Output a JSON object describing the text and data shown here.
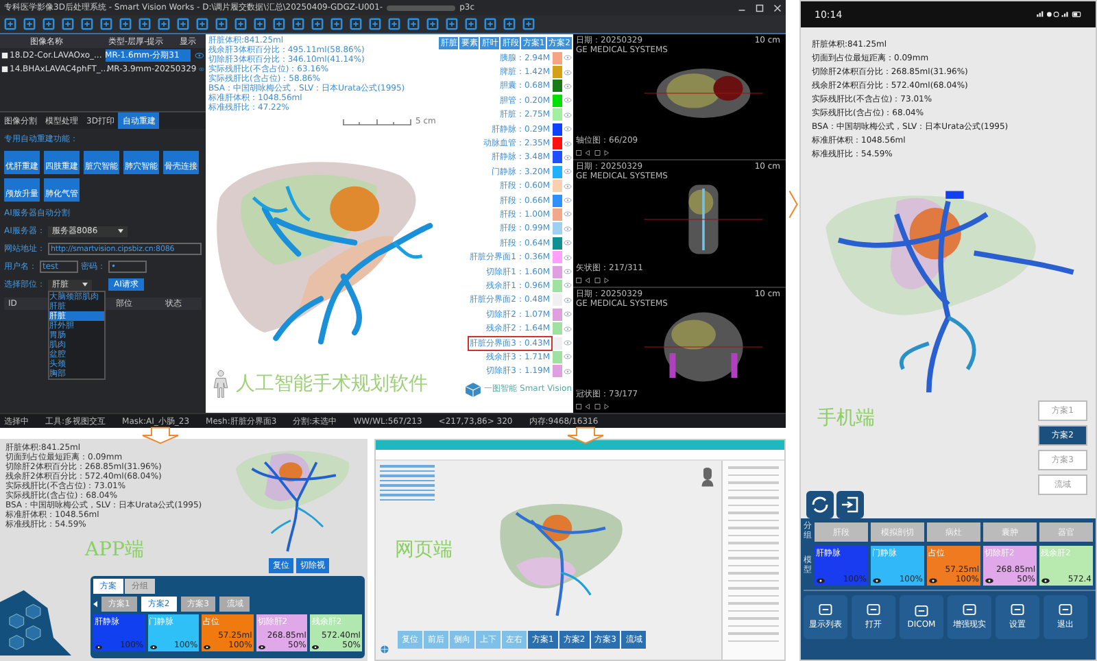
{
  "desktop": {
    "title": "专科医学影像3D后处理系统 - Smart Vision Works - D:\\调片履交数据\\汇总\\20250409-GDGZ-U001-",
    "file_suffix": "p3c",
    "series_table": {
      "columns": [
        "图像名称",
        "类型-层厚-提示",
        "显示"
      ],
      "rows": [
        {
          "name": "18.D2-Cor.LAVAOxo_...",
          "type": "MR-1.6mm-分期31",
          "selected": true
        },
        {
          "name": "14.BHAxLAVAC4phFT_...",
          "type": "MR-3.9mm-20250329",
          "selected": false
        }
      ]
    },
    "tabs": [
      {
        "label": "图像分割",
        "selected": false
      },
      {
        "label": "模型处理",
        "selected": false
      },
      {
        "label": "3D打印",
        "selected": false
      },
      {
        "label": "自动重建",
        "selected": true
      }
    ],
    "auto_recon": {
      "heading": "专用自动重建功能：",
      "buttons": [
        "优肝重建",
        "四肢重建",
        "脏穴智能",
        "肺穴智能",
        "骨壳连接",
        "颅放升量",
        "肺化气管"
      ]
    },
    "ai": {
      "heading": "AI服务器自动分割",
      "server_label": "AI服务器：",
      "server_value": "服务器8086",
      "url_label": "网站地址：",
      "url_value": "http://smartvision.cipsbiz.cn:8086",
      "user_label": "用户名：",
      "user_value": "test",
      "password_label": "密码：",
      "password_value": "•",
      "part_label": "选择部位：",
      "part_value": "肝脏",
      "request_button": "AI请求",
      "options": [
        {
          "label": "大脑颈部肌肉",
          "selected": false
        },
        {
          "label": "肝脏",
          "selected": false
        },
        {
          "label": "肝脏",
          "selected": true
        },
        {
          "label": "肝外胆",
          "selected": false
        },
        {
          "label": "胃肠",
          "selected": false
        },
        {
          "label": "肌肉",
          "selected": false
        },
        {
          "label": "盆腔",
          "selected": false
        },
        {
          "label": "头颈",
          "selected": false
        },
        {
          "label": "胸部",
          "selected": false
        }
      ]
    },
    "result_table": {
      "columns": [
        "ID",
        "部位",
        "状态"
      ]
    },
    "viewport": {
      "stats": [
        "肝脏体积:841.25ml",
        "残余肝3体积百分比：495.11ml(58.86%)",
        "切除肝3体积百分比：346.10ml(41.14%)",
        "实际残肝比(不含占位)：63.16%",
        "实际残肝比(含占位)：58.86%",
        "BSA：中国胡咏梅公式，SLV：日本Urata公式(1995)",
        "标准肝体积：1048.56ml",
        "标准残肝比：47.22%"
      ],
      "scale": "5 cm",
      "overlay_title": "人工智能手术规划软件",
      "logo_cn": "一图智能",
      "logo_en": "Smart Vision"
    },
    "models": {
      "tabs": [
        "肝脏",
        "要素",
        "肝叶",
        "肝段",
        "方案1",
        "方案2"
      ],
      "items": [
        {
          "label": "胰腺：2.94M",
          "color": "#f4a582",
          "selected": false
        },
        {
          "label": "脾脏：1.42M",
          "color": "#d4a017",
          "selected": false
        },
        {
          "label": "胆囊：0.68M",
          "color": "#1a7a1a",
          "selected": false
        },
        {
          "label": "胆管：0.20M",
          "color": "#00e000",
          "selected": false
        },
        {
          "label": "肝脏：2.75M",
          "color": "#a0f0a0",
          "selected": false
        },
        {
          "label": "肝静脉：0.29M",
          "color": "#1040ff",
          "selected": false
        },
        {
          "label": "动脉血管：2.35M",
          "color": "#ff1010",
          "selected": false
        },
        {
          "label": "肝静脉：3.48M",
          "color": "#2050ff",
          "selected": false
        },
        {
          "label": "门静脉：3.20M",
          "color": "#20b0ff",
          "selected": false
        },
        {
          "label": "肝段：0.60M",
          "color": "#f8d0b0",
          "selected": false
        },
        {
          "label": "肝段：0.66M",
          "color": "#3090ff",
          "selected": false
        },
        {
          "label": "肝段：1.00M",
          "color": "#f4a88a",
          "selected": false
        },
        {
          "label": "肝段：0.99M",
          "color": "#a0d0f0",
          "selected": false
        },
        {
          "label": "肝段：0.64M",
          "color": "#109090",
          "selected": false
        },
        {
          "label": "肝脏分界面1：0.36M",
          "color": "#ffa0ff",
          "selected": false
        },
        {
          "label": "切除肝1：1.60M",
          "color": "#e0a0e0",
          "selected": false
        },
        {
          "label": "残余肝1：0.96M",
          "color": "#a0e0a0",
          "selected": false
        },
        {
          "label": "肝脏分界面2：0.48M",
          "color": "#f0f0f0",
          "selected": false
        },
        {
          "label": "切除肝2：1.07M",
          "color": "#e0a0e0",
          "selected": false
        },
        {
          "label": "残余肝2：1.64M",
          "color": "#a0e0a0",
          "selected": false
        },
        {
          "label": "肝脏分界面3：0.43M",
          "color": "#f0f0f0",
          "selected": true
        },
        {
          "label": "残余肝3：1.71M",
          "color": "#a0e0a0",
          "selected": false
        },
        {
          "label": "切除肝3：1.19M",
          "color": "#e0a0e0",
          "selected": false
        }
      ]
    },
    "ct_views": [
      {
        "date": "日期：20250329",
        "maker": "GE MEDICAL SYSTEMS",
        "scale": "10 cm",
        "slice": "轴位图：66/209"
      },
      {
        "date": "日期：20250329",
        "maker": "GE MEDICAL SYSTEMS",
        "scale": "10 cm",
        "slice": "矢状图：217/311"
      },
      {
        "date": "日期：20250329",
        "maker": "GE MEDICAL SYSTEMS",
        "scale": "10 cm",
        "slice": "冠状图：73/177"
      }
    ],
    "status_bar": [
      "选择中",
      "工具:多视图交互",
      "Mask:AI_小肠_23",
      "Mesh:肝脏分界面3",
      "分割:未选中",
      "WW/WL:567/213",
      "<217,73,86> 320",
      "内存:9468/16316"
    ]
  },
  "app": {
    "stats": [
      "肝脏体积:841.25ml",
      "切面到占位最短距离：0.09mm",
      "切除肝2体积百分比：268.85ml(31.96%)",
      "残余肝2体积百分比：572.40ml(68.04%)",
      "实际残肝比(不含占位)：73.01%",
      "实际残肝比(含占位)：68.04%",
      "BSA：中国胡咏梅公式，SLV：日本Urata公式(1995)",
      "标准肝体积：1048.56ml",
      "标准残肝比：54.59%"
    ],
    "title": "APP端",
    "tabs": [
      {
        "label": "方案",
        "selected": true
      },
      {
        "label": "分组",
        "selected": false
      }
    ],
    "actions": [
      "复位",
      "切除视"
    ],
    "schemes": [
      {
        "label": "方案1",
        "selected": false
      },
      {
        "label": "方案2",
        "selected": true
      },
      {
        "label": "方案3",
        "selected": false
      },
      {
        "label": "流域",
        "selected": false
      }
    ],
    "models": [
      {
        "name": "肝静脉",
        "percent": "100%",
        "color": "#1040f0"
      },
      {
        "name": "门静脉",
        "percent": "100%",
        "color": "#30c0f8"
      },
      {
        "name": "占位",
        "volume": "57.25ml",
        "percent": "100%",
        "color": "#f07a10"
      },
      {
        "name": "切除肝2",
        "volume": "268.85ml",
        "percent": "50%",
        "color": "#e0a8e8"
      },
      {
        "name": "残余肝2",
        "volume": "572.40ml",
        "percent": "50%",
        "color": "#b0e8b0"
      }
    ]
  },
  "web": {
    "title": "网页端",
    "toolbar": [
      {
        "label": "复位",
        "kind": "view"
      },
      {
        "label": "前后",
        "kind": "view"
      },
      {
        "label": "侧向",
        "kind": "view"
      },
      {
        "label": "上下",
        "kind": "view"
      },
      {
        "label": "左右",
        "kind": "view"
      },
      {
        "label": "方案1",
        "kind": "scheme"
      },
      {
        "label": "方案2",
        "kind": "scheme"
      },
      {
        "label": "方案3",
        "kind": "scheme"
      },
      {
        "label": "流域",
        "kind": "scheme"
      }
    ]
  },
  "phone": {
    "time": "10:14",
    "stats": [
      "肝脏体积:841.25ml",
      "切面到占位最短距离：0.09mm",
      "切除肝2体积百分比：268.85ml(31.96%)",
      "残余肝2体积百分比：572.40ml(68.04%)",
      "实际残肝比(不含占位)：73.01%",
      "实际残肝比(含占位)：68.04%",
      "BSA：中国胡咏梅公式，SLV：日本Urata公式(1995)",
      "标准肝体积：1048.56ml",
      "标准残肝比：54.59%"
    ],
    "title": "手机端",
    "schemes": [
      {
        "label": "方案1",
        "selected": false
      },
      {
        "label": "方案2",
        "selected": true
      },
      {
        "label": "方案3",
        "selected": false
      },
      {
        "label": "流域",
        "selected": false
      }
    ],
    "group_label": "分组",
    "groups": [
      "肝段",
      "模拟剖切",
      "病灶",
      "囊肿",
      "器官"
    ],
    "model_label": "模型",
    "models": [
      {
        "name": "肝静脉",
        "percent": "100%",
        "color": "#1a3cf0"
      },
      {
        "name": "门静脉",
        "percent": "100%",
        "color": "#30b8f8"
      },
      {
        "name": "占位",
        "volume": "57.25ml",
        "percent": "100%",
        "color": "#f07a20"
      },
      {
        "name": "切除肝2",
        "volume": "268.85ml",
        "percent": "50%",
        "color": "#e0a8e8"
      },
      {
        "name": "残余肝2",
        "volume": "572.4",
        "color": "#b8eab0"
      }
    ],
    "nav": [
      "显示列表",
      "打开",
      "DICOM",
      "增强现实",
      "设置",
      "退出"
    ]
  }
}
